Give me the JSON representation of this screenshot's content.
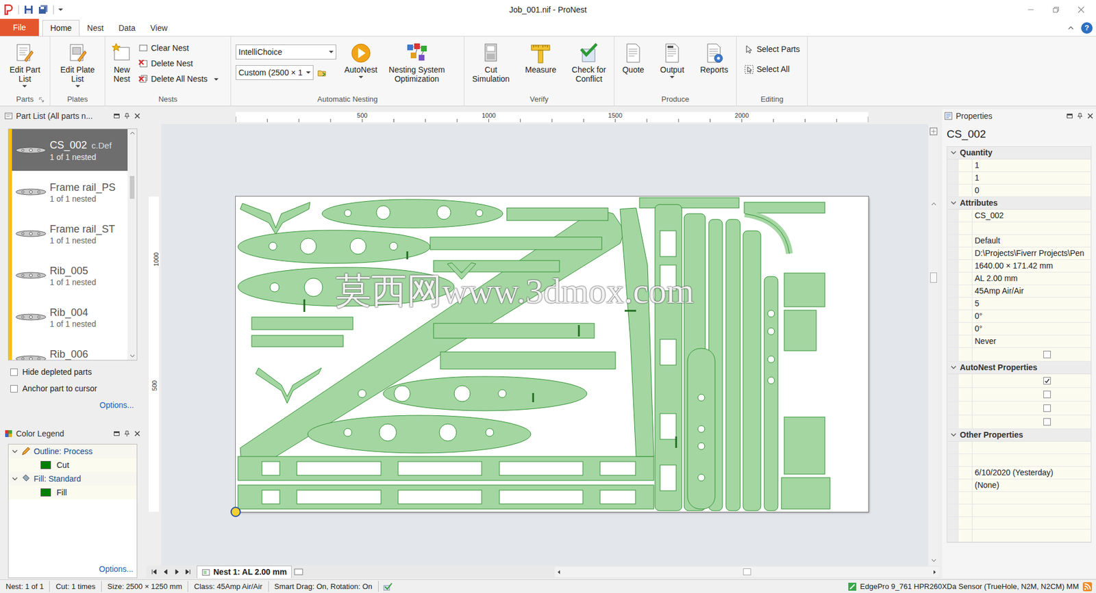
{
  "window": {
    "title": "Job_001.nif - ProNest"
  },
  "help": "?",
  "ribbon_tabs": [
    {
      "label": "File",
      "kind": "file",
      "selected": false
    },
    {
      "label": "Home",
      "kind": "tab",
      "selected": true
    },
    {
      "label": "Nest",
      "kind": "tab",
      "selected": false
    },
    {
      "label": "Data",
      "kind": "tab",
      "selected": false
    },
    {
      "label": "View",
      "kind": "tab",
      "selected": false
    }
  ],
  "ribbon": {
    "groups": {
      "parts": "Parts",
      "plates": "Plates",
      "nests": "Nests",
      "automatic_nesting": "Automatic Nesting",
      "verify": "Verify",
      "produce": "Produce",
      "editing": "Editing"
    },
    "edit_part_list": {
      "lines": [
        "Edit Part",
        "List"
      ],
      "dropdown": true
    },
    "edit_plate_list": {
      "lines": [
        "Edit Plate",
        "List"
      ],
      "dropdown": true
    },
    "new_nest": {
      "lines": [
        "New",
        "Nest"
      ],
      "dropdown": false
    },
    "clear_nest": "Clear Nest",
    "delete_nest": "Delete Nest",
    "delete_all_nests": {
      "label": "Delete All Nests",
      "dropdown": true
    },
    "strategy": "IntelliChoice",
    "plate_size": "Custom (2500 × 1",
    "autonest": {
      "lines": [
        "AutoNest"
      ],
      "dropdown": true
    },
    "nso": {
      "lines": [
        "Nesting System",
        "Optimization"
      ],
      "dropdown": false
    },
    "cut_simulation": {
      "lines": [
        "Cut",
        "Simulation"
      ],
      "dropdown": false
    },
    "measure": {
      "lines": [
        "Measure"
      ],
      "dropdown": false
    },
    "check_conflict": {
      "lines": [
        "Check for",
        "Conflict"
      ],
      "dropdown": false
    },
    "quote": {
      "lines": [
        "Quote"
      ],
      "dropdown": false
    },
    "output": {
      "lines": [
        "Output"
      ],
      "dropdown": true
    },
    "reports": {
      "lines": [
        "Reports"
      ],
      "dropdown": false
    },
    "select_parts": "Select Parts",
    "select_all": "Select All"
  },
  "part_list": {
    "title": "Part List (All parts n...",
    "items": [
      {
        "name": "CS_002",
        "suffix": "c.Def",
        "nested": "1 of 1 nested",
        "selected": true
      },
      {
        "name": "Frame rail_PS",
        "suffix": "",
        "nested": "1 of 1 nested",
        "selected": false
      },
      {
        "name": "Frame rail_ST",
        "suffix": "",
        "nested": "1 of 1 nested",
        "selected": false
      },
      {
        "name": "Rib_005",
        "suffix": "",
        "nested": "1 of 1 nested",
        "selected": false
      },
      {
        "name": "Rib_004",
        "suffix": "",
        "nested": "1 of 1 nested",
        "selected": false
      },
      {
        "name": "Rib_006",
        "suffix": "",
        "nested": "",
        "selected": false
      }
    ],
    "options": [
      {
        "label": "Hide depleted parts",
        "checked": false
      },
      {
        "label": "Anchor part to cursor",
        "checked": false
      }
    ],
    "options_link": "Options..."
  },
  "color_legend": {
    "title": "Color Legend",
    "groups": [
      {
        "label": "Outline: Process",
        "expanded": true,
        "items": [
          {
            "label": "Cut",
            "color": "#008000"
          }
        ]
      },
      {
        "label": "Fill: Standard",
        "expanded": true,
        "items": [
          {
            "label": "Fill",
            "color": "#008000"
          }
        ]
      }
    ],
    "options_link": "Options..."
  },
  "canvas": {
    "rulers": {
      "horizontal": [
        "500",
        "1000",
        "1500",
        "2000"
      ],
      "vertical": [
        "1000",
        "500"
      ]
    },
    "watermark": "莫西网www.3dmox.com",
    "nest_tab": "Nest 1: AL 2.00 mm"
  },
  "properties": {
    "title": "Properties",
    "part": "CS_002",
    "sections": [
      {
        "label": "Quantity",
        "expanded": true,
        "rows": [
          {
            "kind": "text",
            "value": "1"
          },
          {
            "kind": "text",
            "value": "1"
          },
          {
            "kind": "text",
            "value": "0"
          }
        ]
      },
      {
        "label": "Attributes",
        "expanded": true,
        "rows": [
          {
            "kind": "text",
            "value": "CS_002"
          },
          {
            "kind": "text",
            "value": ""
          },
          {
            "kind": "text",
            "value": "Default"
          },
          {
            "kind": "text",
            "value": "D:\\Projects\\Fiverr Projects\\Pen"
          },
          {
            "kind": "text",
            "value": "1640.00 × 171.42 mm"
          },
          {
            "kind": "text",
            "value": "AL 2.00 mm"
          },
          {
            "kind": "text",
            "value": "45Amp Air/Air"
          },
          {
            "kind": "text",
            "value": "5"
          },
          {
            "kind": "text",
            "value": "0°"
          },
          {
            "kind": "text",
            "value": "0°"
          },
          {
            "kind": "text",
            "value": "Never"
          },
          {
            "kind": "checkbox",
            "checked": false
          }
        ]
      },
      {
        "label": "AutoNest Properties",
        "expanded": true,
        "rows": [
          {
            "kind": "checkbox",
            "checked": true
          },
          {
            "kind": "checkbox",
            "checked": false
          },
          {
            "kind": "checkbox",
            "checked": false
          },
          {
            "kind": "checkbox",
            "checked": false
          }
        ]
      },
      {
        "label": "Other Properties",
        "expanded": true,
        "rows": [
          {
            "kind": "text",
            "value": ""
          },
          {
            "kind": "text",
            "value": ""
          },
          {
            "kind": "text",
            "value": "6/10/2020 (Yesterday)"
          },
          {
            "kind": "text",
            "value": "(None)"
          },
          {
            "kind": "text",
            "value": ""
          },
          {
            "kind": "text",
            "value": ""
          },
          {
            "kind": "text",
            "value": ""
          },
          {
            "kind": "text",
            "value": ""
          }
        ]
      }
    ]
  },
  "status_bar": {
    "items": [
      "Nest: 1 of 1",
      "Cut: 1 times",
      "Size: 2500 × 1250 mm",
      "Class: 45Amp Air/Air",
      "Smart Drag: On, Rotation: On"
    ],
    "machine": "EdgePro 9_761 HPR260XDa Sensor (TrueHole, N2M, N2CM) MM"
  }
}
